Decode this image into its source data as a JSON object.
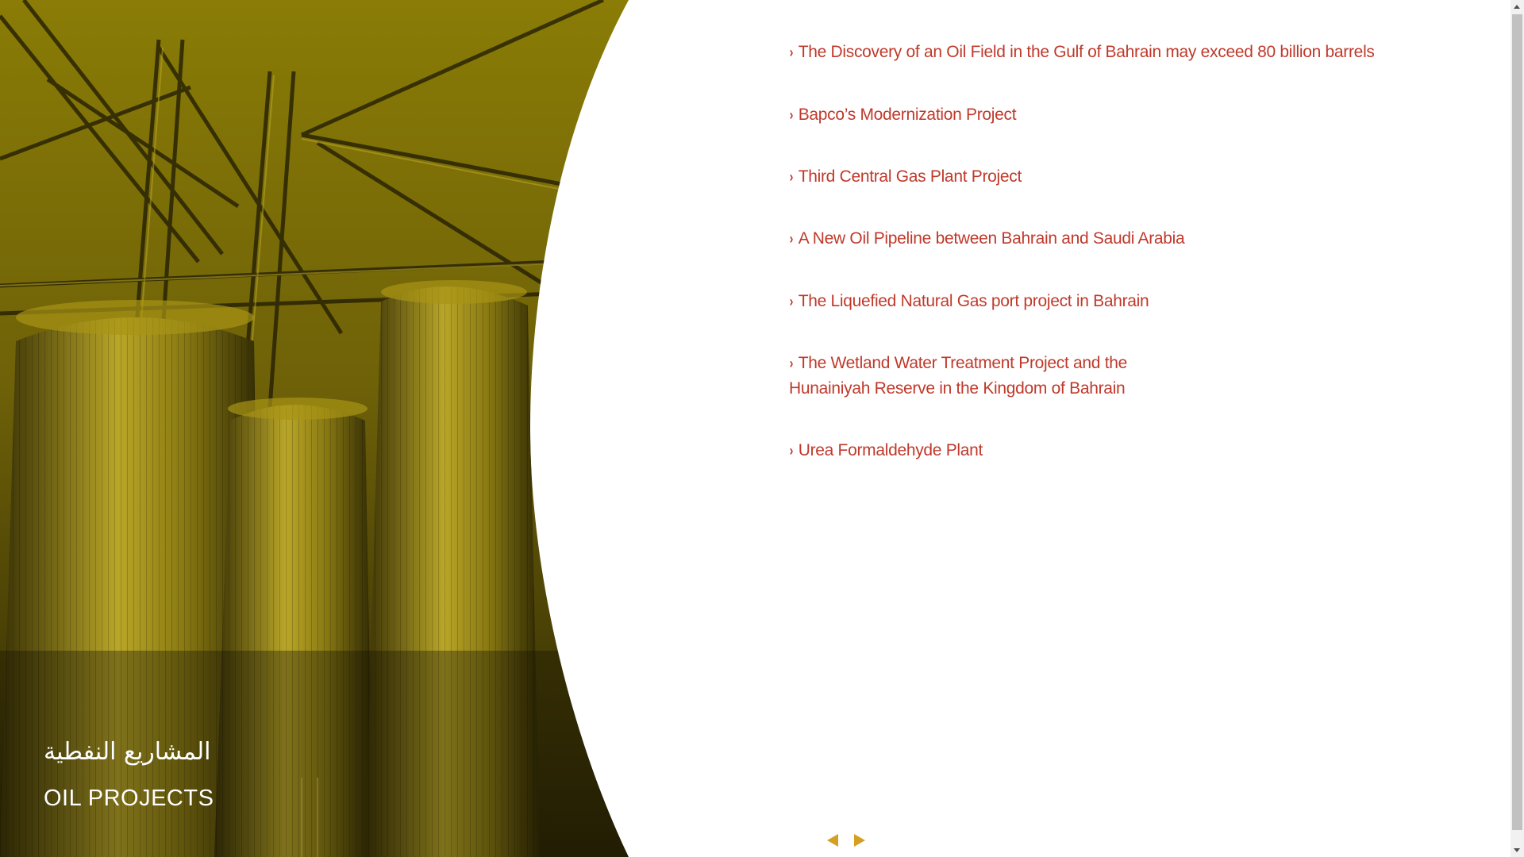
{
  "hero": {
    "title_ar": "المشاريع النفطية",
    "title_en": "OIL PROJECTS"
  },
  "projects": {
    "items": [
      {
        "label": "The Discovery of an Oil Field in the Gulf of Bahrain may exceed 80 billion barrels"
      },
      {
        "label": "Bapco’s Modernization Project"
      },
      {
        "label": "Third Central Gas Plant Project"
      },
      {
        "label": "A New Oil Pipeline between Bahrain and Saudi Arabia"
      },
      {
        "label": "The Liquefied Natural Gas port project in Bahrain"
      },
      {
        "label": "The Wetland Water Treatment Project and the Hunainiyah Reserve in the Kingdom of Bahrain"
      },
      {
        "label": "Urea Formaldehyde Plant"
      }
    ]
  },
  "pager": {
    "prev_icon": "triangle-left-icon",
    "next_icon": "triangle-right-icon"
  },
  "colors": {
    "accent": "#c0392b",
    "hero_tint": "#8a7a10",
    "arrow": "#d4a021"
  }
}
